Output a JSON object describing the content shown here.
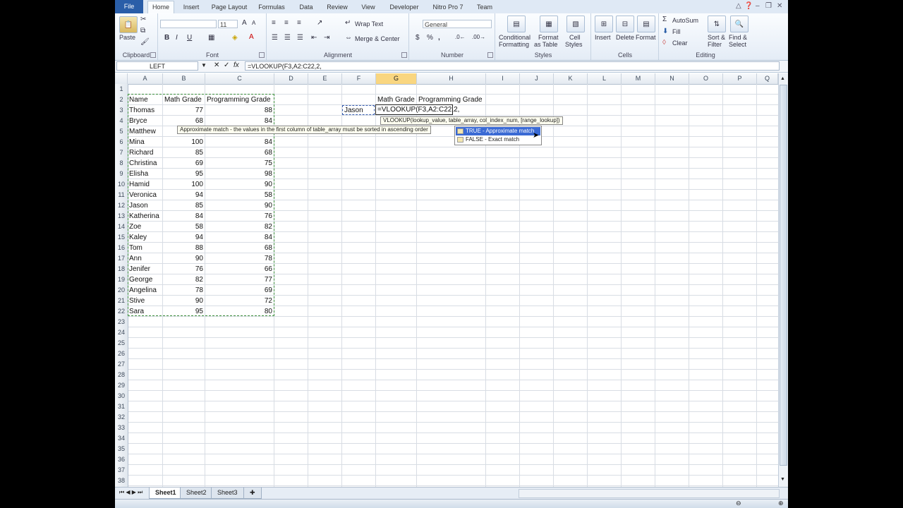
{
  "ribbon": {
    "tabs": [
      "File",
      "Home",
      "Insert",
      "Page Layout",
      "Formulas",
      "Data",
      "Review",
      "View",
      "Developer",
      "Nitro Pro 7",
      "Team"
    ],
    "clipboard": {
      "paste": "Paste",
      "label": "Clipboard"
    },
    "font": {
      "size": "11",
      "bold": "B",
      "italic": "I",
      "underline": "U",
      "label": "Font"
    },
    "alignment": {
      "wrap_text": "Wrap Text",
      "merge_center": "Merge & Center",
      "label": "Alignment"
    },
    "number": {
      "format": "General",
      "currency": "$",
      "percent": "%",
      "comma": ",",
      "label": "Number"
    },
    "styles": {
      "conditional": "Conditional",
      "conditional2": "Formatting",
      "format_table": "Format",
      "format_table2": "as Table",
      "cell_styles": "Cell",
      "cell_styles2": "Styles",
      "label": "Styles"
    },
    "cells": {
      "insert": "Insert",
      "delete": "Delete",
      "format": "Format",
      "label": "Cells"
    },
    "editing": {
      "autosum": "AutoSum",
      "fill": "Fill",
      "clear": "Clear",
      "sort": "Sort &",
      "sort2": "Filter",
      "find": "Find &",
      "find2": "Select",
      "label": "Editing"
    }
  },
  "formula_bar": {
    "name_box": "LEFT",
    "formula": "=VLOOKUP(F3,A2:C22,2,"
  },
  "grid": {
    "columns": [
      "A",
      "B",
      "C",
      "D",
      "E",
      "F",
      "G",
      "H",
      "I",
      "J",
      "K",
      "L",
      "M",
      "N",
      "O",
      "P",
      "Q"
    ],
    "rows": [
      "1",
      "2",
      "3",
      "4",
      "5",
      "6",
      "7",
      "8",
      "9",
      "10",
      "11",
      "12",
      "13",
      "14",
      "15",
      "16",
      "17",
      "18",
      "19",
      "20",
      "21",
      "22",
      "23",
      "24",
      "25",
      "26",
      "27",
      "28",
      "29",
      "30",
      "31",
      "32",
      "33",
      "34",
      "35",
      "36",
      "37",
      "38"
    ],
    "header": {
      "name": "Name",
      "math": "Math Grade",
      "prog": "Programming Grade"
    },
    "data": [
      {
        "name": "Thomas",
        "math": "77",
        "prog": "88"
      },
      {
        "name": "Bryce",
        "math": "68",
        "prog": "84"
      },
      {
        "name": "Matthew",
        "math": "",
        "prog": ""
      },
      {
        "name": "Mina",
        "math": "100",
        "prog": "84"
      },
      {
        "name": "Richard",
        "math": "85",
        "prog": "68"
      },
      {
        "name": "Christina",
        "math": "69",
        "prog": "75"
      },
      {
        "name": "Elisha",
        "math": "95",
        "prog": "98"
      },
      {
        "name": "Hamid",
        "math": "100",
        "prog": "90"
      },
      {
        "name": "Veronica",
        "math": "94",
        "prog": "58"
      },
      {
        "name": "Jason",
        "math": "85",
        "prog": "90"
      },
      {
        "name": "Katherina",
        "math": "84",
        "prog": "76"
      },
      {
        "name": "Zoe",
        "math": "58",
        "prog": "82"
      },
      {
        "name": "Kaley",
        "math": "94",
        "prog": "84"
      },
      {
        "name": "Tom",
        "math": "88",
        "prog": "68"
      },
      {
        "name": "Ann",
        "math": "90",
        "prog": "78"
      },
      {
        "name": "Jenifer",
        "math": "76",
        "prog": "66"
      },
      {
        "name": "George",
        "math": "82",
        "prog": "77"
      },
      {
        "name": "Angelina",
        "math": "78",
        "prog": "69"
      },
      {
        "name": "Stive",
        "math": "90",
        "prog": "72"
      },
      {
        "name": "Sara",
        "math": "95",
        "prog": "80"
      }
    ],
    "lookup": {
      "g2": "Math Grade",
      "h2": "Programming Grade",
      "f3": "Jason",
      "g3": "=VLOOKUP(F3,A2:C22,2,"
    }
  },
  "tooltips": {
    "syntax": "VLOOKUP(lookup_value, table_array, col_index_num, [range_lookup])",
    "approx_note": "Approximate match - the values in the first column of table_array must be sorted in ascending order"
  },
  "autocomplete": {
    "opt_true": "TRUE - Approximate match",
    "opt_false": "FALSE - Exact match"
  },
  "sheets": [
    "Sheet1",
    "Sheet2",
    "Sheet3"
  ]
}
